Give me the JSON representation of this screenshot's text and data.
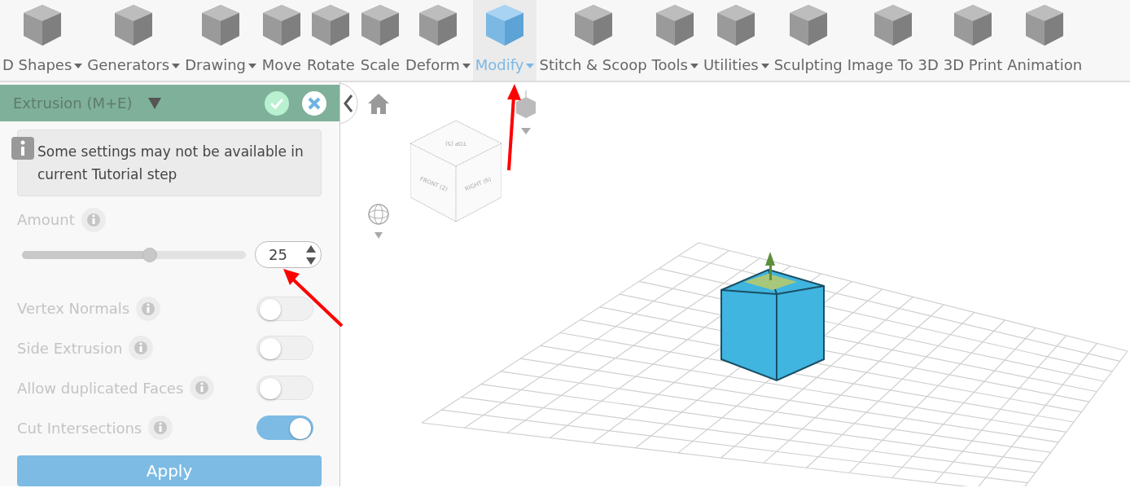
{
  "toolbar": [
    {
      "label": "D Shapes",
      "dropdown": true,
      "selected": false
    },
    {
      "label": "Generators",
      "dropdown": true,
      "selected": false
    },
    {
      "label": "Drawing",
      "dropdown": true,
      "selected": false
    },
    {
      "label": "Move",
      "dropdown": false,
      "selected": false
    },
    {
      "label": "Rotate",
      "dropdown": false,
      "selected": false
    },
    {
      "label": "Scale",
      "dropdown": false,
      "selected": false
    },
    {
      "label": "Deform",
      "dropdown": true,
      "selected": false
    },
    {
      "label": "Modify",
      "dropdown": true,
      "selected": true
    },
    {
      "label": "Stitch & Scoop",
      "dropdown": false,
      "selected": false
    },
    {
      "label": "Tools",
      "dropdown": true,
      "selected": false
    },
    {
      "label": "Utilities",
      "dropdown": true,
      "selected": false
    },
    {
      "label": "Sculpting",
      "dropdown": false,
      "selected": false
    },
    {
      "label": "Image To 3D",
      "dropdown": false,
      "selected": false
    },
    {
      "label": "3D Print",
      "dropdown": false,
      "selected": false
    },
    {
      "label": "Animation",
      "dropdown": false,
      "selected": false
    }
  ],
  "panel": {
    "title": "Extrusion (M+E)",
    "notice": "Some settings may not be available in current Tutorial step",
    "amount": {
      "label": "Amount",
      "level": 0.57,
      "value": "25"
    },
    "options": [
      {
        "label": "Vertex Normals",
        "on": false
      },
      {
        "label": "Side Extrusion",
        "on": false
      },
      {
        "label": "Allow duplicated Faces",
        "on": false
      },
      {
        "label": "Cut Intersections",
        "on": true
      }
    ],
    "apply": "Apply"
  },
  "view_cube": {
    "top": "TOP (5)",
    "front": "FRONT (2)",
    "right": "RIGHT (6)"
  }
}
